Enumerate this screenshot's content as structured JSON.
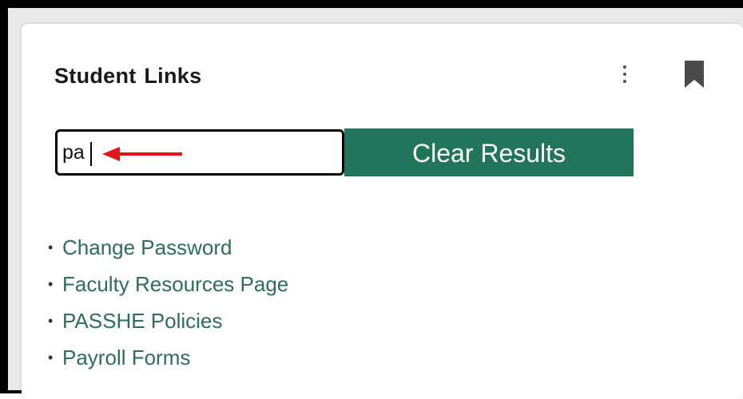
{
  "card": {
    "title": "Student Links",
    "menu_icon": "more-vertical-icon",
    "bookmark_icon": "bookmark-icon"
  },
  "search": {
    "value": "pa",
    "placeholder": ""
  },
  "clear_button": {
    "label": "Clear Results"
  },
  "annotation": {
    "icon": "red-arrow-left-icon",
    "color": "#e3151b"
  },
  "results": [
    {
      "label": "Change Password"
    },
    {
      "label": "Faculty Resources Page"
    },
    {
      "label": "PASSHE Policies"
    },
    {
      "label": "Payroll Forms"
    }
  ],
  "colors": {
    "accent": "#21755a",
    "link": "#2e6e57",
    "annotation": "#e3151b"
  }
}
